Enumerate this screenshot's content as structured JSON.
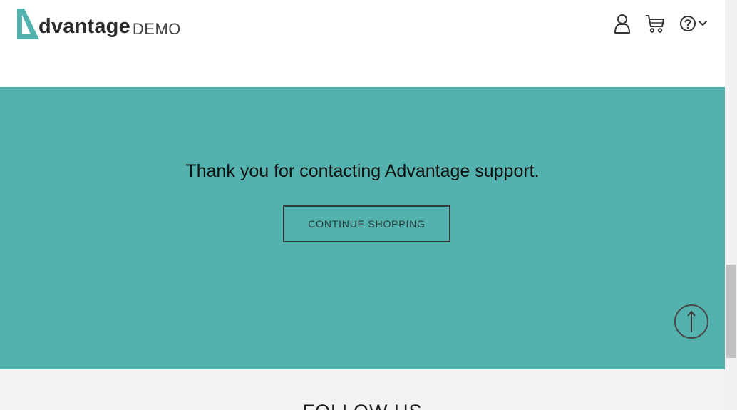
{
  "header": {
    "logo_word": "dvantage",
    "logo_demo": "DEMO",
    "icons": [
      "user-icon",
      "cart-icon",
      "help-icon",
      "chevron-down-icon"
    ]
  },
  "confirmation": {
    "message": "Thank you for contacting Advantage support.",
    "continue_label": "CONTINUE SHOPPING",
    "scroll_top_icon": "arrow-up-icon"
  },
  "footer": {
    "follow_label": "FOLLOW US"
  },
  "colors": {
    "brand_teal": "#53b2ad",
    "header_bg": "#ffffff",
    "footer_bg": "#f3f3f2",
    "text_dark": "#111111"
  }
}
